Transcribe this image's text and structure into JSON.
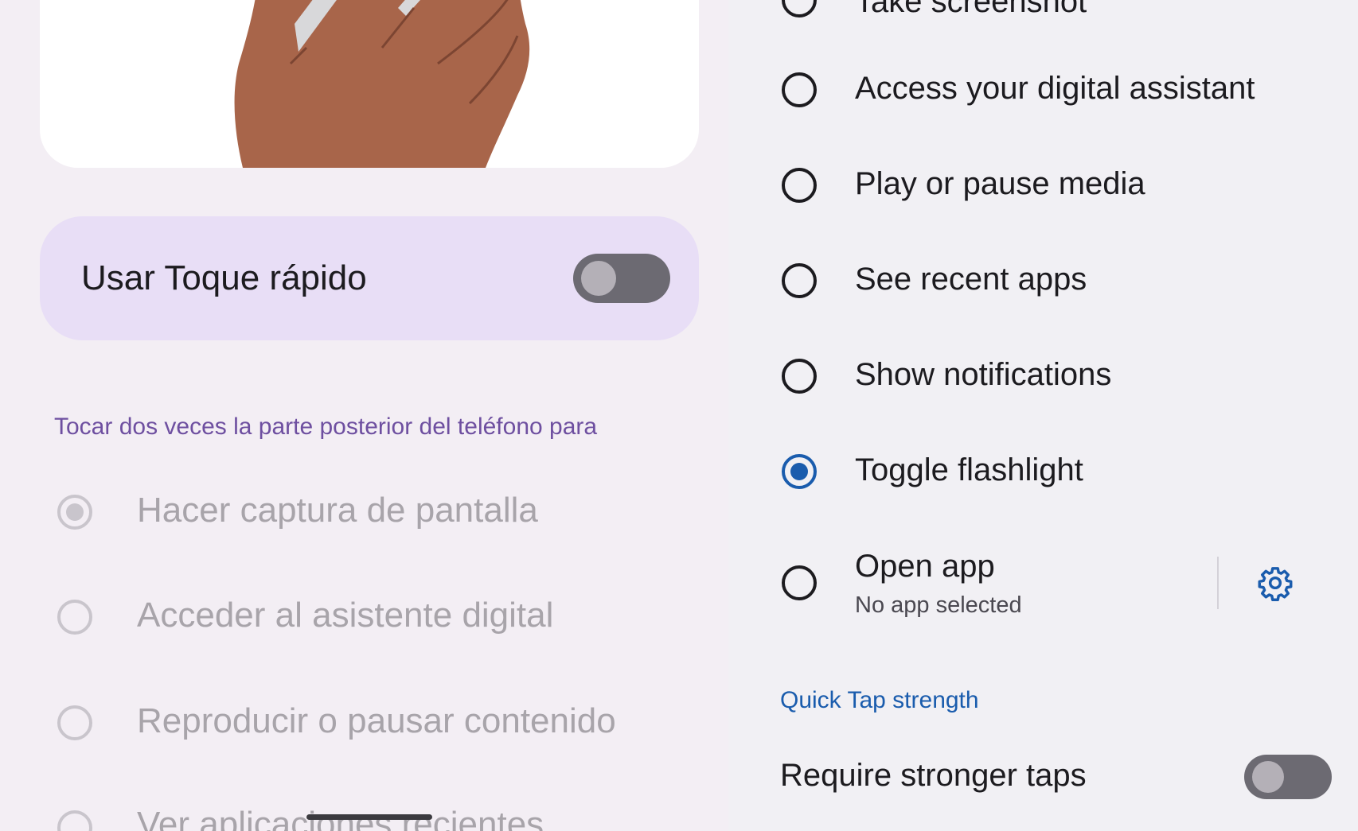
{
  "left": {
    "quick_tap_toggle": {
      "label": "Usar Toque rápido",
      "state": "off"
    },
    "section_header": "Tocar dos veces la parte posterior del teléfono para",
    "options": [
      {
        "label": "Hacer captura de pantalla",
        "selected": true
      },
      {
        "label": "Acceder al asistente digital",
        "selected": false
      },
      {
        "label": "Reproducir o pausar contenido",
        "selected": false
      },
      {
        "label": "Ver aplicaciones recientes",
        "selected": false
      }
    ]
  },
  "right": {
    "options": [
      {
        "label": "Take screenshot",
        "selected": false
      },
      {
        "label": "Access your digital assistant",
        "selected": false
      },
      {
        "label": "Play or pause media",
        "selected": false
      },
      {
        "label": "See recent apps",
        "selected": false
      },
      {
        "label": "Show notifications",
        "selected": false
      },
      {
        "label": "Toggle flashlight",
        "selected": true
      },
      {
        "label": "Open app",
        "sublabel": "No app selected",
        "selected": false
      }
    ],
    "strength_header": "Quick Tap strength",
    "stronger_taps": {
      "label": "Require stronger taps",
      "state": "off"
    }
  },
  "colors": {
    "accent_purple": "#6e4fa0",
    "accent_blue": "#1a5cad",
    "card_lavender": "#e8def6",
    "hand": "#a8654a"
  }
}
